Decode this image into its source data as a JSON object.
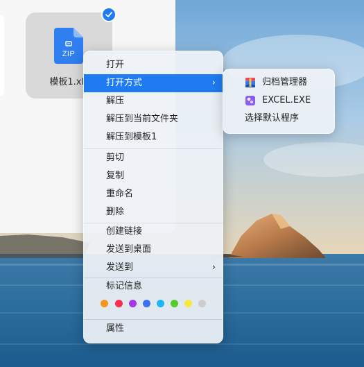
{
  "file": {
    "name": "模板1.xlsx",
    "icon_text": "ZIP",
    "selected": true
  },
  "context_menu": {
    "items": [
      {
        "label": "打开"
      },
      {
        "label": "打开方式",
        "has_submenu": true,
        "active": true
      },
      {
        "label": "解压"
      },
      {
        "label": "解压到当前文件夹"
      },
      {
        "label": "解压到模板1"
      },
      {
        "label": "剪切"
      },
      {
        "label": "复制"
      },
      {
        "label": "重命名"
      },
      {
        "label": "删除"
      },
      {
        "label": "创建链接"
      },
      {
        "label": "发送到桌面"
      },
      {
        "label": "发送到",
        "has_submenu": true
      },
      {
        "label": "标记信息"
      },
      {
        "label": "属性"
      }
    ],
    "submenu_arrow": "›",
    "tag_colors": [
      "#f7961e",
      "#f6314f",
      "#a238e8",
      "#3e6ff5",
      "#1eb7f5",
      "#54cc29",
      "#f8e83c",
      "#cccccc"
    ]
  },
  "open_with_submenu": {
    "items": [
      {
        "label": "归档管理器",
        "icon": "archive-manager-icon"
      },
      {
        "label": "EXCEL.EXE",
        "icon": "wine-app-icon"
      },
      {
        "label": "选择默认程序"
      }
    ]
  },
  "colors": {
    "accent": "#1e7bf2"
  }
}
